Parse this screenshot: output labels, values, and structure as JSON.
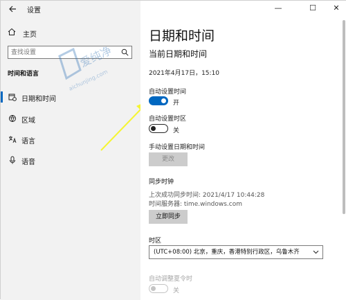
{
  "window": {
    "app_title": "设置",
    "controls": {
      "minimize": "—",
      "maximize": "☐",
      "close": "✕"
    }
  },
  "sidebar": {
    "home_label": "主页",
    "search_placeholder": "查找设置",
    "section_heading": "时间和语言",
    "items": [
      {
        "label": "日期和时间",
        "icon": "calendar-clock-icon",
        "active": true
      },
      {
        "label": "区域",
        "icon": "globe-icon",
        "active": false
      },
      {
        "label": "语言",
        "icon": "language-icon",
        "active": false
      },
      {
        "label": "语音",
        "icon": "microphone-icon",
        "active": false
      }
    ]
  },
  "watermark": {
    "text_main": "爱纯净",
    "text_url": "aichunjing.com"
  },
  "main": {
    "page_title": "日期和时间",
    "section_current": "当前日期和时间",
    "current_datetime": "2021年4月17日，15:10",
    "auto_time": {
      "label": "自动设置时间",
      "state": "开",
      "on": true
    },
    "auto_timezone": {
      "label": "自动设置时区",
      "state": "关",
      "on": false
    },
    "manual_set": {
      "label": "手动设置日期和时间",
      "button": "更改"
    },
    "sync": {
      "heading": "同步时钟",
      "last_sync": "上次成功同步时间: 2021/4/17 10:44:28",
      "server": "时间服务器: time.windows.com",
      "button": "立即同步"
    },
    "timezone": {
      "heading": "时区",
      "value": "(UTC+08:00) 北京，重庆，香港特别行政区，乌鲁木齐"
    },
    "dst": {
      "label": "自动调整夏令时",
      "state": "关",
      "on": false
    }
  },
  "colors": {
    "accent": "#0067c0",
    "sidebar_bg": "#f2f2f2",
    "arrow": "#f5f532"
  }
}
